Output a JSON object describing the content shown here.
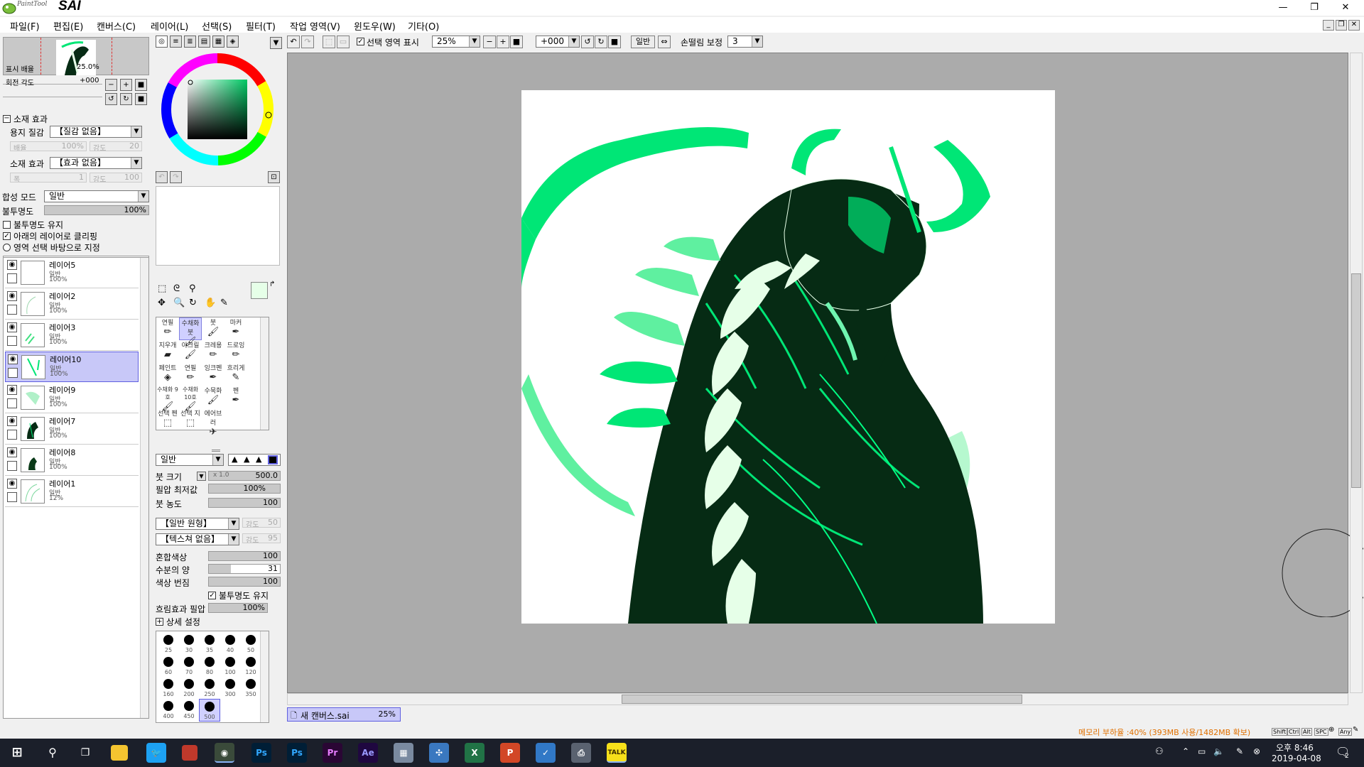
{
  "app": {
    "logo_small": "PaintTool",
    "logo_big": "SAI",
    "window_controls": [
      "minimize-icon",
      "restore-icon",
      "close-icon"
    ]
  },
  "menu": [
    "파일(F)",
    "편집(E)",
    "캔버스(C)",
    "레이어(L)",
    "선택(S)",
    "필터(T)",
    "작업 영역(V)",
    "윈도우(W)",
    "기타(O)"
  ],
  "navigator": {
    "zoom_label": "표시 배율",
    "zoom_value": "25.0%",
    "rotate_label": "회전 각도",
    "rotate_value": "+000"
  },
  "material": {
    "section_label": "소재 효과",
    "paper_label": "용지 질감",
    "paper_value": "【질감 없음】",
    "paper_scale_label": "배율",
    "paper_scale_value": "100%",
    "paper_strength_label": "강도",
    "paper_strength_value": "20",
    "effect_label": "소재 효과",
    "effect_value": "【효과 없음】",
    "effect_width_label": "폭",
    "effect_width_value": "1",
    "effect_strength_label": "강도",
    "effect_strength_value": "100"
  },
  "layer_props": {
    "blend_label": "합성 모드",
    "blend_value": "일반",
    "opacity_label": "불투명도",
    "opacity_value": "100%",
    "opacity_fraction": 1.0,
    "keep_opacity": "불투명도 유지",
    "clip": "아래의 레이어로 클리핑",
    "selection_source": "영역 선택 바탕으로 지정"
  },
  "layers": [
    {
      "name": "레이어5",
      "mode": "일반",
      "opacity": "100%",
      "selected": false
    },
    {
      "name": "레이어2",
      "mode": "일반",
      "opacity": "100%",
      "selected": false
    },
    {
      "name": "레이어3",
      "mode": "일반",
      "opacity": "100%",
      "selected": false
    },
    {
      "name": "레이어10",
      "mode": "일반",
      "opacity": "100%",
      "selected": true
    },
    {
      "name": "레이어9",
      "mode": "일반",
      "opacity": "100%",
      "selected": false
    },
    {
      "name": "레이어7",
      "mode": "일반",
      "opacity": "100%",
      "selected": false
    },
    {
      "name": "레이어8",
      "mode": "일반",
      "opacity": "100%",
      "selected": false
    },
    {
      "name": "레이어1",
      "mode": "일반",
      "opacity": "12%",
      "selected": false
    }
  ],
  "tools": [
    {
      "label": "연필",
      "icon": "pencil-icon"
    },
    {
      "label": "수채화붓",
      "icon": "watercolor-icon",
      "selected": true
    },
    {
      "label": "붓",
      "icon": "brush-icon"
    },
    {
      "label": "마커",
      "icon": "marker-icon"
    },
    {
      "label": "지우개",
      "icon": "eraser-icon"
    },
    {
      "label": "아크릴",
      "icon": "acrylic-icon"
    },
    {
      "label": "크레용",
      "icon": "crayon-icon"
    },
    {
      "label": "드로잉",
      "icon": "drawing-icon"
    },
    {
      "label": "페인트",
      "icon": "bucket-icon"
    },
    {
      "label": "연필",
      "icon": "pencil-icon"
    },
    {
      "label": "잉크펜",
      "icon": "inkpen-icon"
    },
    {
      "label": "흐리게",
      "icon": "blur-icon"
    },
    {
      "label": "수채화 9호",
      "icon": "watercolor-icon"
    },
    {
      "label": "수채화 10호",
      "icon": "watercolor-icon"
    },
    {
      "label": "수묵화",
      "icon": "ink-icon"
    },
    {
      "label": "펜",
      "icon": "pen-icon"
    },
    {
      "label": "선택 펜",
      "icon": "select-pen-icon"
    },
    {
      "label": "선택 지",
      "icon": "select-eraser-icon"
    },
    {
      "label": "에어브러",
      "icon": "airbrush-icon"
    }
  ],
  "brush": {
    "mode_value": "일반",
    "size_label": "붓 크기",
    "size_multiplier": "x 1.0",
    "size_value": "500.0",
    "min_pressure_label": "필압 최저값",
    "min_pressure_value": "100%",
    "density_label": "붓 농도",
    "density_value": "100",
    "shape_value": "【일반 원형】",
    "shape_strength_label": "강도",
    "shape_strength_value": "50",
    "texture_value": "【텍스쳐 없음】",
    "texture_strength_label": "강도",
    "texture_strength_value": "95",
    "blend_label": "혼합색상",
    "blend_value": "100",
    "water_label": "수분의 양",
    "water_value": "31",
    "persist_label": "색상 번짐",
    "persist_value": "100",
    "keep_opacity": "불투명도 유지",
    "blur_pressure_label": "흐림효과 필압",
    "blur_pressure_value": "100%",
    "advanced_label": "상세 설정"
  },
  "brush_sizes": [
    "25",
    "30",
    "35",
    "40",
    "50",
    "60",
    "70",
    "80",
    "100",
    "120",
    "160",
    "200",
    "250",
    "300",
    "350",
    "400",
    "450",
    "500"
  ],
  "canvas_toolbar": {
    "show_selection": "선택 영역 표시",
    "zoom": "25%",
    "angle": "+000",
    "mode": "일반",
    "stabilizer_label": "손떨림 보정",
    "stabilizer_value": "3"
  },
  "document_tab": {
    "name": "새 캔버스.sai",
    "zoom": "25%"
  },
  "status": {
    "memory": "메모리 부하율 :40% (393MB 사용/1482MB 확보)",
    "keys": [
      "Shift",
      "Ctrl",
      "Alt",
      "SPC",
      "Any"
    ]
  },
  "taskbar": {
    "apps": [
      "Ps",
      "Ps",
      "Pr",
      "Ae"
    ],
    "clock_time": "오후 8:46",
    "clock_date": "2019-04-08",
    "notification_count": "2"
  },
  "colors": {
    "accent_green": "#00e676",
    "dark_green": "#062b14",
    "mint": "#e6ffe8",
    "selection": "#c8c8f8"
  }
}
